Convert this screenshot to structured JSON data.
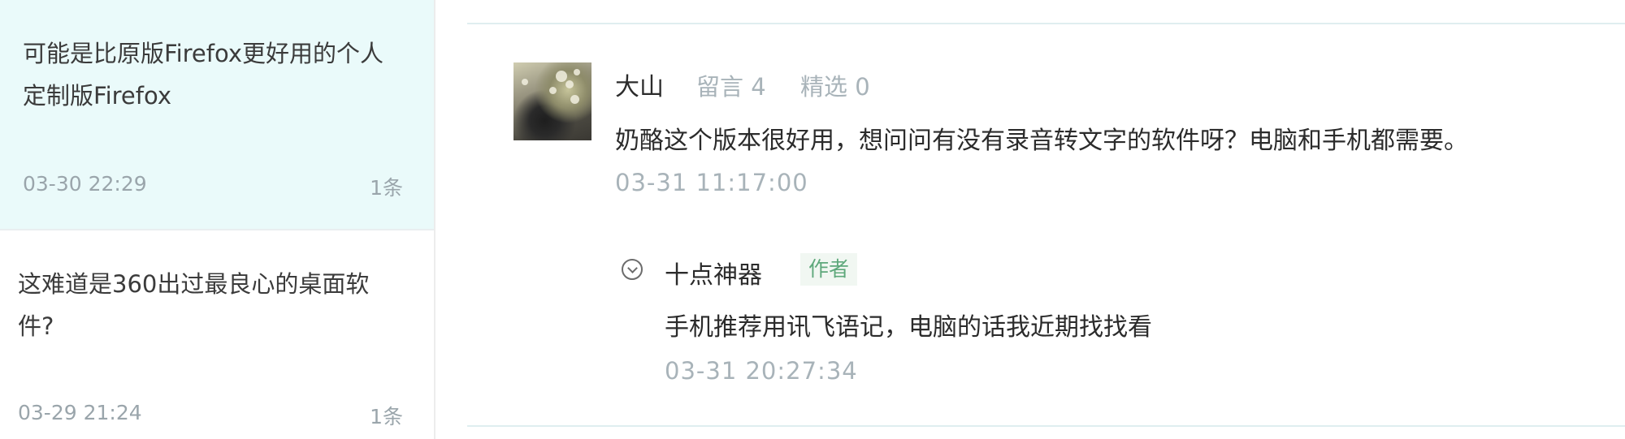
{
  "articles": [
    {
      "title": "可能是比原版Firefox更好用的个人定制版Firefox",
      "date": "03-30 22:29",
      "count": "1条",
      "active": true
    },
    {
      "title": "这难道是360出过最良心的桌面软件?",
      "date": "03-29 21:24",
      "count": "1条",
      "active": false
    }
  ],
  "comment": {
    "user_name": "大山",
    "stats": {
      "messages_label": "留言 4",
      "featured_label": "精选 0"
    },
    "text": "奶酪这个版本很好用，想问问有没有录音转文字的软件呀？电脑和手机都需要。",
    "time": "03-31 11:17:00",
    "reply": {
      "author": "十点神器",
      "badge": "作者",
      "text": "手机推荐用讯飞语记，电脑的话我近期找找看",
      "time": "03-31 20:27:34"
    }
  },
  "colors": {
    "active_item_bg": "#eafafa",
    "muted_text": "#a8b3b9",
    "author_badge_text": "#5ea87b"
  },
  "icons": {
    "reply_toggle": "chevron-circle-down-icon"
  }
}
